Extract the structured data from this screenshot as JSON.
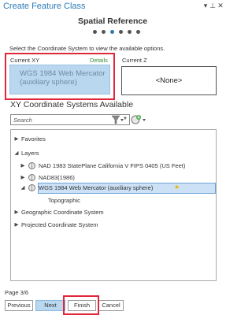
{
  "window": {
    "title": "Create Feature Class",
    "controls": {
      "dropdown": "▾",
      "pin": "⊥",
      "close": "✕"
    }
  },
  "page": {
    "heading": "Spatial Reference",
    "steps_total": 6,
    "current_step": 3,
    "instructions": "Select the Coordinate System to view the available options."
  },
  "current_xy": {
    "label": "Current XY",
    "details_link": "Details",
    "line1": "WGS 1984 Web Mercator",
    "line2": "(auxiliary sphere)"
  },
  "current_z": {
    "label": "Current Z",
    "value": "<None>"
  },
  "xy_systems": {
    "title": "XY Coordinate Systems Available",
    "search_placeholder": "Search"
  },
  "tree": {
    "favorites": "Favorites",
    "layers": "Layers",
    "nad83_stateplane": "NAD 1983 StatePlane California V FIPS 0405 (US Feet)",
    "nad83_1986": "NAD83(1986)",
    "wgs84_web_mercator": "WGS 1984 Web Mercator (auxiliary sphere)",
    "topographic": "Topographic",
    "geographic": "Geographic Coordinate System",
    "projected": "Projected Coordinate System"
  },
  "footer": {
    "page_indicator": "Page 3/6",
    "previous": "Previous",
    "next": "Next",
    "finish": "Finish",
    "cancel": "Cancel"
  },
  "colors": {
    "accent": "#2b7bb9",
    "highlight_outline": "#e0263a",
    "selection_fill": "#b9d7ef",
    "details_link": "#3a8f3a"
  }
}
